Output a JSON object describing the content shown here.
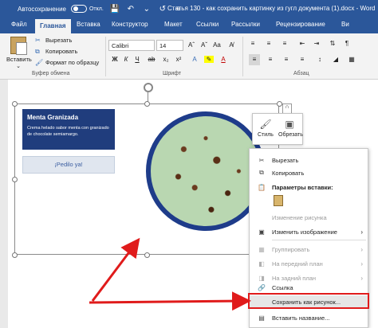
{
  "titlebar": {
    "autosave_label": "Автосохранение",
    "autosave_state": "Откл.",
    "document_title": "Статья 130 - как сохранить картинку из гугл документа (1).docx - Word"
  },
  "tabs": [
    {
      "label": "Файл"
    },
    {
      "label": "Главная"
    },
    {
      "label": "Вставка"
    },
    {
      "label": "Конструктор"
    },
    {
      "label": "Макет"
    },
    {
      "label": "Ссылки"
    },
    {
      "label": "Рассылки"
    },
    {
      "label": "Рецензирование"
    },
    {
      "label": "Ви"
    }
  ],
  "clipboard": {
    "paste_label": "Вставить",
    "cut_label": "Вырезать",
    "copy_label": "Копировать",
    "format_painter_label": "Формат по образцу",
    "group_label": "Буфер обмена"
  },
  "font": {
    "font_name": "Calibri",
    "font_size": "14",
    "group_label": "Шрифт"
  },
  "paragraph": {
    "group_label": "Абзац"
  },
  "document": {
    "card_title": "Menta Granizada",
    "card_text": "Crema helado sabor menta con granizado de chocolate semiamargo.",
    "order_button": "¡Pedilo ya!"
  },
  "mini_toolbar": {
    "style_label": "Стиль",
    "crop_label": "Обрезать"
  },
  "context_menu": {
    "items": [
      {
        "label": "Вырезать",
        "icon": "scissors-icon",
        "enabled": true
      },
      {
        "label": "Копировать",
        "icon": "copy-icon",
        "enabled": true
      },
      {
        "label": "Параметры вставки:",
        "icon": "paste-icon",
        "enabled": true
      },
      {
        "label": "Изменение рисунка",
        "icon": "",
        "enabled": false
      },
      {
        "label": "Изменить изображение",
        "icon": "picture-icon",
        "enabled": true
      },
      {
        "label": "Группировать",
        "icon": "group-icon",
        "enabled": false
      },
      {
        "label": "На передний план",
        "icon": "bring-forward-icon",
        "enabled": false
      },
      {
        "label": "На задний план",
        "icon": "send-backward-icon",
        "enabled": false
      },
      {
        "label": "Ссылка",
        "icon": "link-icon",
        "enabled": true
      },
      {
        "label": "Сохранить как рисунок...",
        "icon": "",
        "enabled": true
      },
      {
        "label": "Вставить название...",
        "icon": "caption-icon",
        "enabled": true
      }
    ]
  },
  "colors": {
    "word_blue": "#2b579a",
    "annotation_red": "#e01b1b",
    "card_blue": "#203d7d"
  }
}
